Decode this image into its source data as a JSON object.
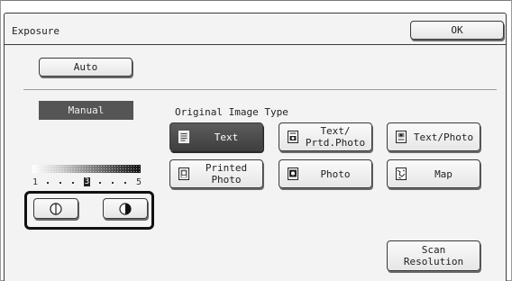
{
  "window": {
    "title": "Exposure",
    "ok_label": "OK"
  },
  "exposure": {
    "auto_label": "Auto",
    "manual_label": "Manual",
    "scale_min": "1",
    "scale_max": "5",
    "scale_current": "3",
    "lighter_icon": "half-circle-light-icon",
    "darker_icon": "half-circle-dark-icon"
  },
  "image_type": {
    "section_label": "Original Image Type",
    "buttons": [
      {
        "label": "Text",
        "icon": "text-document-icon",
        "selected": true
      },
      {
        "label": "Text/\nPrtd.Photo",
        "icon": "text-printed-photo-icon",
        "selected": false
      },
      {
        "label": "Text/Photo",
        "icon": "text-photo-icon",
        "selected": false
      },
      {
        "label": "Printed\nPhoto",
        "icon": "printed-photo-icon",
        "selected": false
      },
      {
        "label": "Photo",
        "icon": "photo-icon",
        "selected": false
      },
      {
        "label": "Map",
        "icon": "map-icon",
        "selected": false
      }
    ]
  },
  "scan_resolution_label": "Scan\nResolution",
  "colors": {
    "selected_bg": "#4a4a4a",
    "panel_bg": "#f3f3f3",
    "border": "#3a3a3a"
  }
}
